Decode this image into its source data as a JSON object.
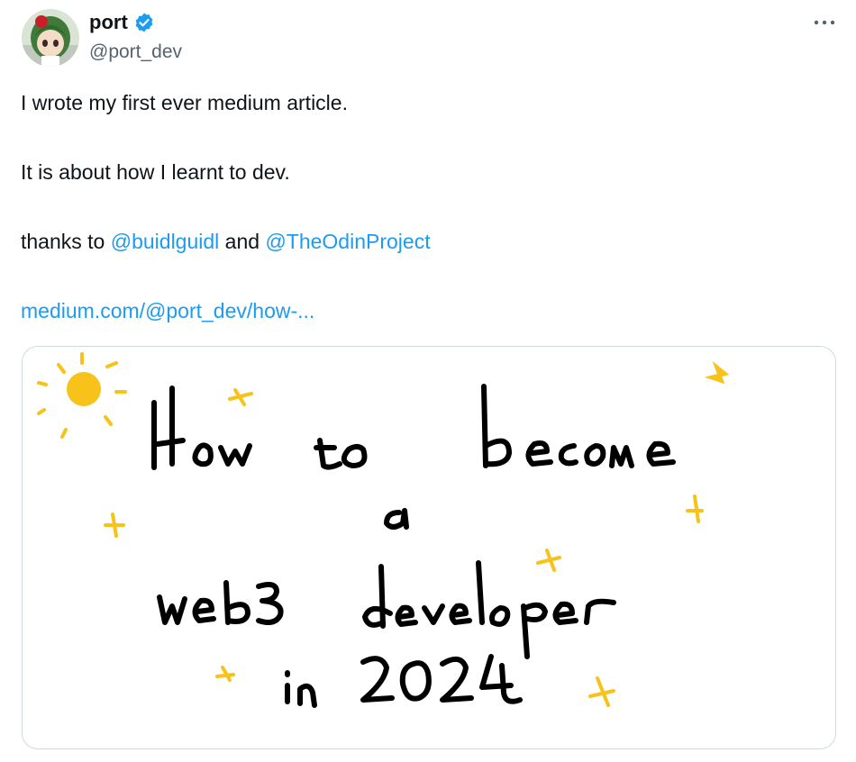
{
  "author": {
    "display_name": "port",
    "handle": "@port_dev",
    "verified": true,
    "avatar_icon": "avatar-image"
  },
  "tweet": {
    "line1": "I wrote my first ever medium article.",
    "line2": "It is about how I learnt to dev.",
    "line3_prefix": "thanks to ",
    "mention1": "@buidlguidl",
    "line3_middle": " and ",
    "mention2": "@TheOdinProject",
    "url": "medium.com/@port_dev/how-..."
  },
  "more_label": "···",
  "card_image": {
    "words": [
      "How",
      "to",
      "become",
      "a",
      "web3",
      "developer",
      "in",
      "2024"
    ]
  },
  "colors": {
    "link": "#1d9bf0",
    "verified": "#1d9bf0",
    "handle": "#536471",
    "text": "#0f1419",
    "border": "#cfd9de",
    "sun": "#f7c21a",
    "handwriting": "#000000"
  }
}
